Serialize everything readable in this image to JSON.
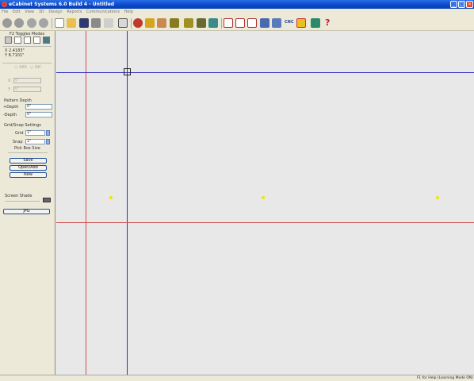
{
  "window": {
    "title": "eCabinet Systems 6.0 Build 4 - Untitled"
  },
  "menu": [
    "File",
    "Edit",
    "View",
    "3D",
    "Design",
    "Reports",
    "Communications",
    "Help"
  ],
  "toolbar": {
    "icons": [
      "back-icon",
      "forward-icon",
      "zoom-out-icon",
      "zoom-in-icon",
      "new-icon",
      "open-icon",
      "save-icon",
      "print-icon",
      "undo-icon",
      "properties-icon",
      "material-icon",
      "parts-icon",
      "edit-icon",
      "cabinet-icon",
      "cabinet-group-icon",
      "cabinet-stack-icon",
      "pattern-icon",
      "report-icon",
      "report-edit-icon",
      "report-copy-icon",
      "export-icon",
      "import-icon",
      "settings-icon",
      "cnc-icon",
      "cutlist-icon",
      "monitor-icon",
      "help-icon"
    ],
    "cnc_label": "CNC"
  },
  "sidebar": {
    "toggle_modes_label": "F2 Toggles Modes",
    "coord_x": "X 2.4183\"",
    "coord_y": "Y 8.7101\"",
    "abs_label": "ABS",
    "inc_label": "INC",
    "x_label": "X",
    "x_value": "0\"",
    "y_label": "Y",
    "y_value": "0\"",
    "pattern_depth_label": "Pattern Depth",
    "depth_plus_label": "+Depth",
    "depth_plus_value": "0\"",
    "depth_minus_label": "-Depth",
    "depth_minus_value": "0\"",
    "grid_snap_label": "Grid/Snap Settings",
    "grid_label": "Grid",
    "grid_value": "1\"",
    "snap_label": "Snap",
    "snap_value": "1\"",
    "pick_box_label": "Pick Box Size",
    "save_button": "Save",
    "open_add_button": "Open/Add",
    "new_button": "New",
    "screen_shade_label": "Screen Shade",
    "jpg_button": "JPG"
  },
  "status": {
    "text": "F1 for Help (Learning Mode ON)"
  },
  "colors": {
    "red_line": "#d05050",
    "blue_line": "#3030c0",
    "dot": "#f2e400"
  }
}
